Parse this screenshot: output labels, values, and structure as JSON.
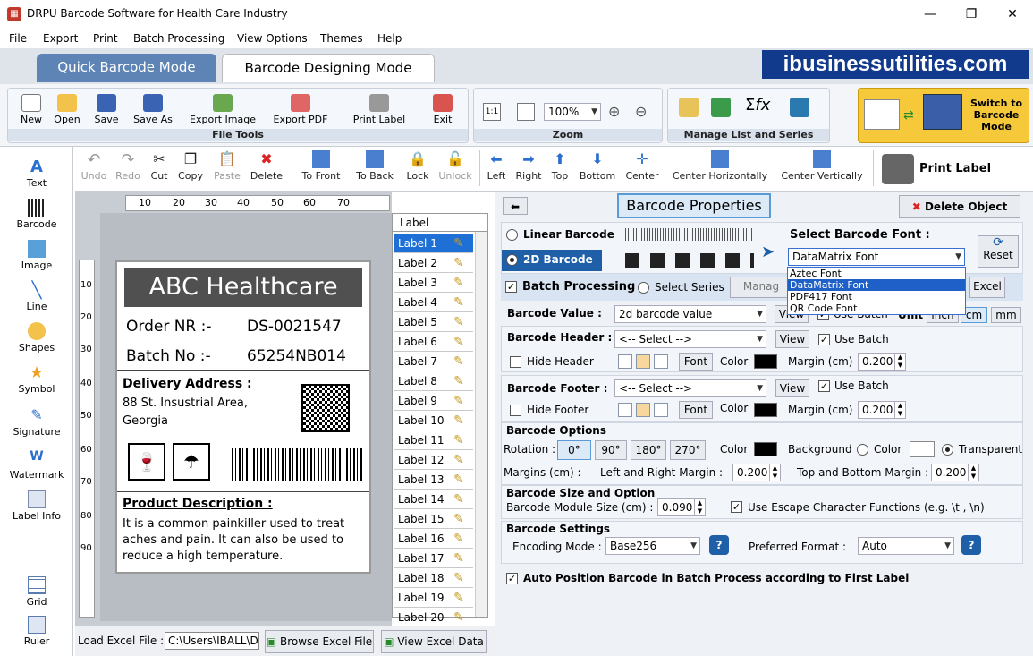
{
  "window": {
    "title": "DRPU Barcode Software for Health Care Industry",
    "minimize": "—",
    "maximize": "❐",
    "close": "✕"
  },
  "menu": [
    "File",
    "Export",
    "Print",
    "Batch Processing",
    "View Options",
    "Themes",
    "Help"
  ],
  "modes": {
    "quick": "Quick Barcode Mode",
    "designing": "Barcode Designing Mode"
  },
  "brand": "ibusinessutilities.com",
  "file_tools": {
    "title": "File Tools",
    "items": [
      "New",
      "Open",
      "Save",
      "Save As",
      "Export Image",
      "Export PDF",
      "Print Label",
      "Exit"
    ]
  },
  "zoom": {
    "title": "Zoom",
    "value": "100%"
  },
  "manage": {
    "title": "Manage List and Series"
  },
  "switch": {
    "line1": "Switch to",
    "line2": "Barcode",
    "line3": "Mode"
  },
  "edit_tools": [
    "Undo",
    "Redo",
    "Cut",
    "Copy",
    "Paste",
    "Delete",
    "To Front",
    "To Back",
    "Lock",
    "Unlock",
    "Left",
    "Right",
    "Top",
    "Bottom",
    "Center",
    "Center Horizontally",
    "Center Vertically"
  ],
  "print_label": "Print Label",
  "left_tools": [
    "Text",
    "Barcode",
    "Image",
    "Line",
    "Shapes",
    "Symbol",
    "Signature",
    "Watermark",
    "Label Info",
    "Grid",
    "Ruler"
  ],
  "ruler": {
    "h": [
      "10",
      "20",
      "30",
      "40",
      "50",
      "60",
      "70"
    ],
    "v": [
      "10",
      "20",
      "30",
      "40",
      "50",
      "60",
      "70",
      "80",
      "90"
    ]
  },
  "card": {
    "header": "ABC Healthcare",
    "order_label": "Order NR :-",
    "order_value": "DS-0021547",
    "batch_label": "Batch No :-",
    "batch_value": "65254NB014",
    "delivery_title": "Delivery Address :",
    "address1": "88 St. Insustrial Area,",
    "address2": "Georgia",
    "desc_title": "Product Description :",
    "desc1": "It is a common painkiller used to treat",
    "desc2": "aches and pain. It can also be used to",
    "desc3": "reduce a high temperature."
  },
  "label_list": {
    "header": "Label",
    "items": [
      "Label 1",
      "Label 2",
      "Label 3",
      "Label 4",
      "Label 5",
      "Label 6",
      "Label 7",
      "Label 8",
      "Label 9",
      "Label 10",
      "Label 11",
      "Label 12",
      "Label 13",
      "Label 14",
      "Label 15",
      "Label 16",
      "Label 17",
      "Label 18",
      "Label 19",
      "Label 20"
    ]
  },
  "excel": {
    "label": "Load Excel File :",
    "path": "C:\\Users\\IBALL\\D",
    "browse": "Browse Excel File",
    "view": "View Excel Data"
  },
  "props": {
    "title": "Barcode Properties",
    "delete": "Delete Object",
    "linear": "Linear Barcode",
    "twod": "2D Barcode",
    "font_title": "Select Barcode Font :",
    "font_value": "DataMatrix Font",
    "font_options": [
      "Aztec Font",
      "DataMatrix Font",
      "PDF417 Font",
      "QR Code Font"
    ],
    "reset": "Reset",
    "batch": "Batch Processing",
    "series": "Select Series",
    "manage": "Manag",
    "excel": "Excel",
    "value_label": "Barcode Value :",
    "value": "2d barcode value",
    "view": "View",
    "use_batch": "Use Batch",
    "unit": "Unit",
    "inch": "inch",
    "cm": "cm",
    "mm": "mm",
    "header_label": "Barcode Header :",
    "select": "<-- Select -->",
    "hide_header": "Hide Header",
    "font": "Font",
    "color": "Color",
    "margin_cm": "Margin (cm)",
    "margin_value": "0.200",
    "footer_label": "Barcode Footer :",
    "hide_footer": "Hide Footer",
    "options_title": "Barcode Options",
    "rotation": "Rotation :",
    "rotations": [
      "0°",
      "90°",
      "180°",
      "270°"
    ],
    "background": "Background",
    "color2": "Color",
    "transparent": "Transparent",
    "margins": "Margins (cm) :",
    "lr_margin": "Left and Right Margin :",
    "lr_value": "0.200",
    "tb_margin": "Top and Bottom Margin :",
    "tb_value": "0.200",
    "size_title": "Barcode Size and Option",
    "module_label": "Barcode Module Size (cm) :",
    "module_value": "0.090",
    "escape": "Use Escape Character Functions (e.g. \\t , \\n)",
    "settings_title": "Barcode Settings",
    "encoding_label": "Encoding Mode :",
    "encoding_value": "Base256",
    "preferred_label": "Preferred Format :",
    "preferred_value": "Auto",
    "auto_position": "Auto Position Barcode in Batch Process according to First Label"
  }
}
